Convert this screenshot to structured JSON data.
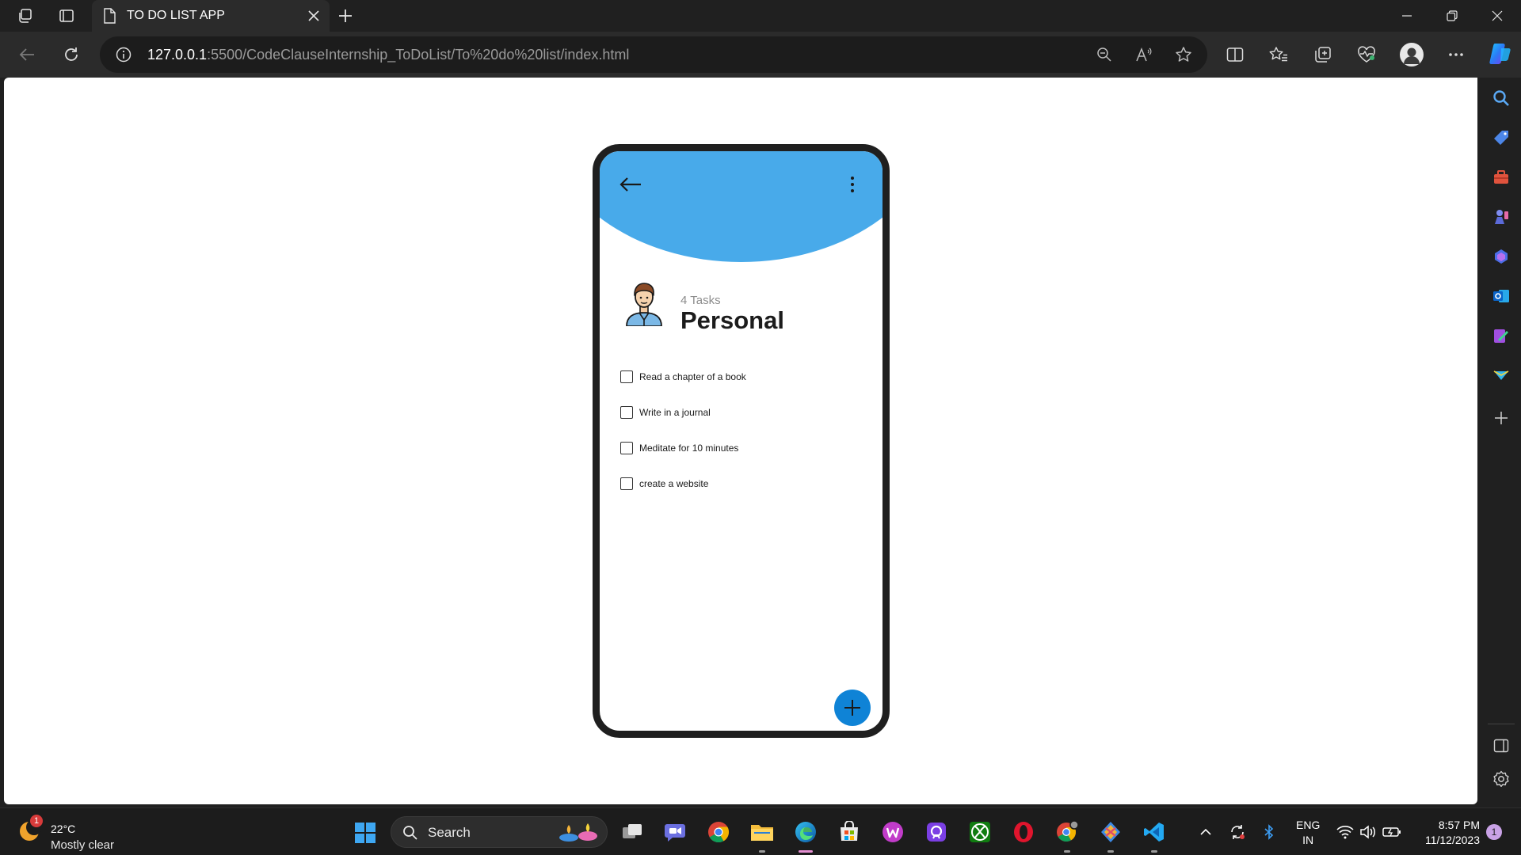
{
  "browser": {
    "tab_title": "TO DO LIST APP",
    "url_host": "127.0.0.1",
    "url_rest": ":5500/CodeClauseInternship_ToDoList/To%20do%20list/index.html"
  },
  "app": {
    "task_count": "4 Tasks",
    "list_title": "Personal",
    "tasks": [
      {
        "label": "Read a chapter of a book",
        "done": false
      },
      {
        "label": "Write in a journal",
        "done": false
      },
      {
        "label": "Meditate for 10 minutes",
        "done": false
      },
      {
        "label": "create a website",
        "done": false
      }
    ],
    "header_color": "#48aaea",
    "fab_color": "#0f83d6"
  },
  "taskbar": {
    "weather_badge": "1",
    "temperature": "22°C",
    "condition": "Mostly clear",
    "search_label": "Search",
    "language_line1": "ENG",
    "language_line2": "IN",
    "time": "8:57 PM",
    "date": "11/12/2023",
    "notification_count": "1"
  },
  "icons": {
    "title_bar": [
      "workspaces-icon",
      "tab-actions-icon",
      "page-icon",
      "close-icon",
      "new-tab-icon",
      "minimize-icon",
      "restore-icon",
      "close-window-icon"
    ],
    "nav": [
      "back-icon",
      "refresh-icon",
      "info-icon",
      "zoom-out-icon",
      "read-aloud-icon",
      "favorite-star-icon",
      "split-screen-icon",
      "favorites-icon",
      "collections-icon",
      "browser-essentials-icon",
      "profile-icon",
      "more-icon",
      "copilot-icon"
    ],
    "sidebar": [
      "search-icon",
      "shopping-tag-icon",
      "tools-icon",
      "games-icon",
      "bing-icon",
      "outlook-icon",
      "designer-icon",
      "drop-icon",
      "add-icon",
      "hide-sidebar-icon",
      "settings-icon"
    ]
  }
}
